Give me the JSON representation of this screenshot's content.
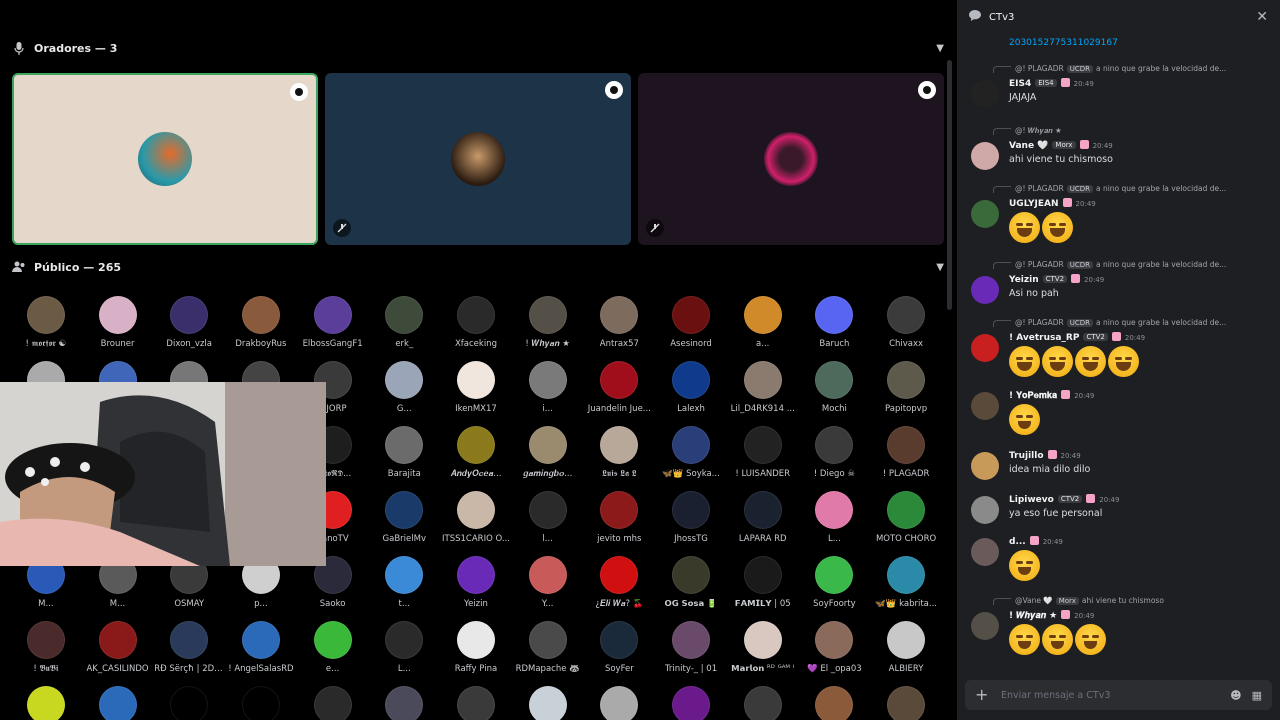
{
  "stage": {
    "speakers_label": "Oradores — 3",
    "audience_label": "Público — 265",
    "colors": {
      "tile1": "#e6d7cb",
      "tile2": "#1c3348",
      "tile3": "#1e1420",
      "tile1_border": "#3ba55d"
    }
  },
  "members": [
    {
      "name": "! 𝖒𝖔𝖗𝖋𝖔𝖗 ☯",
      "color": "#6b5a44"
    },
    {
      "name": "Brouner",
      "color": "#d9b1c6"
    },
    {
      "name": "Dixon_vzla",
      "color": "#3b2f6b"
    },
    {
      "name": "DrakboyRus",
      "color": "#8a5a3c"
    },
    {
      "name": "ElbossGangF1",
      "color": "#5a3e9a"
    },
    {
      "name": "erk_",
      "color": "#3e4a3a"
    },
    {
      "name": "Xfaceking",
      "color": "#2a2a2a"
    },
    {
      "name": "! 𝑾𝒉𝒚𝒂𝒏 ★",
      "color": "#555047"
    },
    {
      "name": "Antrax57",
      "color": "#7d6b5e"
    },
    {
      "name": "Asesinord",
      "color": "#6a1010"
    },
    {
      "name": "a...",
      "color": "#d08a2a"
    },
    {
      "name": "Baruch",
      "color": "#5865f2"
    },
    {
      "name": "Chivaxx",
      "color": "#3b3b3b"
    },
    {
      "name": "",
      "color": "#aaaaaa"
    },
    {
      "name": "",
      "color": "#3f66b8"
    },
    {
      "name": "",
      "color": "#777777"
    },
    {
      "name": "",
      "color": "#444444"
    },
    {
      "name": "IEJORP",
      "color": "#3a3a3a"
    },
    {
      "name": "G...",
      "color": "#9aa6b8"
    },
    {
      "name": "IkenMX17",
      "color": "#f0e6de"
    },
    {
      "name": "i...",
      "color": "#7a7a7a"
    },
    {
      "name": "Juandelin Jue...",
      "color": "#a10e1b"
    },
    {
      "name": "Lalexh",
      "color": "#103a8c"
    },
    {
      "name": "Lil_D4RK914 ...",
      "color": "#8a7b6e"
    },
    {
      "name": "Mochi",
      "color": "#4d6a5c"
    },
    {
      "name": "Papitopvp",
      "color": "#5d5a4b"
    },
    {
      "name": "",
      "color": "#000000"
    },
    {
      "name": "",
      "color": "#000000"
    },
    {
      "name": "",
      "color": "#000000"
    },
    {
      "name": "",
      "color": "#000000"
    },
    {
      "name": "𝕽𝖆𝖙𝖔𝕽𝕯...",
      "color": "#1e1e1e"
    },
    {
      "name": "Barajita",
      "color": "#6b6b6b"
    },
    {
      "name": "𝑨𝒏𝒅𝒚𝑶𝒄𝒆𝒂...",
      "color": "#8a7a1c"
    },
    {
      "name": "𝒈𝒂𝒎𝒊𝒏𝒈𝒃𝒐...",
      "color": "#9a8a6e"
    },
    {
      "name": "𝕷𝖚𝖎𝖘 𝕷𝖆 𝕷",
      "color": "#b8a89a"
    },
    {
      "name": "🦋👑 Soyka...",
      "color": "#2a3e7a"
    },
    {
      "name": "! LUISANDER",
      "color": "#222222"
    },
    {
      "name": "! Diego ☠",
      "color": "#3a3a3a"
    },
    {
      "name": "! PLAGADR",
      "color": "#5a3c2e"
    },
    {
      "name": "",
      "color": "#000000"
    },
    {
      "name": "",
      "color": "#000000"
    },
    {
      "name": "",
      "color": "#000000"
    },
    {
      "name": "",
      "color": "#000000"
    },
    {
      "name": "nanoTV",
      "color": "#e02020"
    },
    {
      "name": "GaBrielMv",
      "color": "#1a3a6a"
    },
    {
      "name": "ITSS1CARIO O...",
      "color": "#c9b8a8"
    },
    {
      "name": "l...",
      "color": "#2a2a2a"
    },
    {
      "name": "jevito mhs",
      "color": "#8c1a1a"
    },
    {
      "name": "JhossTG",
      "color": "#1a2030"
    },
    {
      "name": "LAPARA RD",
      "color": "#1a2230"
    },
    {
      "name": "L...",
      "color": "#e07aa8"
    },
    {
      "name": "MOTO CHORO",
      "color": "#2a8a3a"
    },
    {
      "name": "M...",
      "color": "#2a5ab8"
    },
    {
      "name": "M...",
      "color": "#5a5a5a"
    },
    {
      "name": "OSMAY",
      "color": "#3a3a3a"
    },
    {
      "name": "p...",
      "color": "#cfcfcf"
    },
    {
      "name": "Saoko",
      "color": "#2a2a3a"
    },
    {
      "name": "t...",
      "color": "#3a8ad8"
    },
    {
      "name": "Yeizin",
      "color": "#6a2ab8"
    },
    {
      "name": "Y...",
      "color": "#c85a5a"
    },
    {
      "name": "¿𝑬𝒍𝒊 𝑾𝒂? 🍒",
      "color": "#d01010"
    },
    {
      "name": "𝗢𝗚 𝗦𝗼𝘀𝗮 🔋",
      "color": "#3a3a2a"
    },
    {
      "name": "𝗙𝗔𝗠𝗜𝗟𝗬 | 05",
      "color": "#1a1a1a"
    },
    {
      "name": "SoyFoorty",
      "color": "#3ab84a"
    },
    {
      "name": "🦋👑 kabrita...",
      "color": "#2a8aa8"
    },
    {
      "name": "! 𝕭𝖚𝕭𝖎",
      "color": "#4a2a2a"
    },
    {
      "name": "AK_CASILINDO",
      "color": "#8a1a1a"
    },
    {
      "name": "RĐ Šërçħ | 2D ...",
      "color": "#2a3a5a"
    },
    {
      "name": "! AngelSalasRD",
      "color": "#2a6ab8"
    },
    {
      "name": "e...",
      "color": "#3ab83a"
    },
    {
      "name": "L...",
      "color": "#2a2a2a"
    },
    {
      "name": "Raffy Pina",
      "color": "#e8e8e8"
    },
    {
      "name": "RDMapache 🦝",
      "color": "#4a4a4a"
    },
    {
      "name": "SoyFer",
      "color": "#1a2a3a"
    },
    {
      "name": "Trinity-_ | 01",
      "color": "#6a4a6a"
    },
    {
      "name": "𝗠𝗮𝗿𝗹𝗼𝗻 ᴿᴰ ᴳᴬᴹ ᴵ",
      "color": "#d8c8c0"
    },
    {
      "name": "💜 El _opa03",
      "color": "#8a6a5a"
    },
    {
      "name": "ALBIERY",
      "color": "#c8c8c8"
    },
    {
      "name": "",
      "color": "#c8d820"
    },
    {
      "name": "",
      "color": "#2a6ab8"
    },
    {
      "name": "",
      "color": "#000000"
    },
    {
      "name": "",
      "color": "#000000"
    },
    {
      "name": "",
      "color": "#2a2a2a"
    },
    {
      "name": "",
      "color": "#4a4a5a"
    },
    {
      "name": "",
      "color": "#3a3a3a"
    },
    {
      "name": "",
      "color": "#c8d0d8"
    },
    {
      "name": "",
      "color": "#aaaaaa"
    },
    {
      "name": "",
      "color": "#6a1a8a"
    },
    {
      "name": "",
      "color": "#3a3a3a"
    },
    {
      "name": "",
      "color": "#8a5a3a"
    },
    {
      "name": "",
      "color": "#5a4a3a"
    }
  ],
  "chat": {
    "title": "CTv3",
    "link_text": "2030152775311029167",
    "input_placeholder": "Enviar mensaje a CTv3",
    "messages": [
      {
        "reply_author": "@! PLAGADR",
        "reply_tag": "UCDR",
        "reply_text": "a nino que grabe la velocidad de...",
        "author": "ΕΙS4",
        "tag": "EIS4",
        "time": "20:49",
        "text": "JAJAJA",
        "emoji": 0,
        "avatar": "#222222"
      },
      {
        "reply_author": "@! 𝑾𝒉𝒚𝒂𝒏 ★",
        "reply_tag": "",
        "reply_text": "",
        "author": "Vane 🤍",
        "tag": "Morx",
        "time": "20:49",
        "text": "ahi viene tu chismoso",
        "emoji": 0,
        "avatar": "#cfa8a8"
      },
      {
        "reply_author": "@! PLAGADR",
        "reply_tag": "UCDR",
        "reply_text": "a nino que grabe la velocidad de...",
        "author": "UGLYJEAN",
        "tag": "",
        "time": "20:49",
        "text": "",
        "emoji": 2,
        "kind": "laugh",
        "avatar": "#3a6a3a"
      },
      {
        "reply_author": "@! PLAGADR",
        "reply_tag": "UCDR",
        "reply_text": "a nino que grabe la velocidad de...",
        "author": "Yeizin",
        "tag": "CTV2",
        "time": "20:49",
        "text": "Asi no pah",
        "emoji": 0,
        "avatar": "#6a2ab8"
      },
      {
        "reply_author": "@! PLAGADR",
        "reply_tag": "UCDR",
        "reply_text": "a nino que grabe la velocidad de...",
        "author": "! Avetrusa_RP",
        "tag": "CTV2",
        "time": "20:49",
        "text": "",
        "emoji": 4,
        "kind": "laugh",
        "avatar": "#c82020"
      },
      {
        "reply_author": "",
        "reply_tag": "",
        "reply_text": "",
        "author": "! 𝐘𝐨𝐏𝐞𝐦𝐤𝐚",
        "tag": "",
        "time": "20:49",
        "text": "",
        "emoji": 1,
        "kind": "cry",
        "avatar": "#5a4a3a"
      },
      {
        "reply_author": "",
        "reply_tag": "",
        "reply_text": "",
        "author": "Trujillo",
        "tag": "",
        "time": "20:49",
        "text": "idea mia dilo dilo",
        "emoji": 0,
        "avatar": "#c89a5a"
      },
      {
        "reply_author": "",
        "reply_tag": "",
        "reply_text": "",
        "author": "Lipiwevo",
        "tag": "CTV2",
        "time": "20:49",
        "text": "ya eso fue personal",
        "emoji": 0,
        "avatar": "#8a8a8a"
      },
      {
        "reply_author": "",
        "reply_tag": "",
        "reply_text": "",
        "author": "d...",
        "tag": "",
        "time": "20:49",
        "text": "",
        "emoji": 1,
        "kind": "cry",
        "avatar": "#6a5a5a"
      },
      {
        "reply_author": "@Vane 🤍",
        "reply_tag": "Morx",
        "reply_text": "ahi viene tu chismoso",
        "author": "! 𝑾𝒉𝒚𝒂𝒏 ★",
        "tag": "",
        "time": "20:49",
        "text": "",
        "emoji": 3,
        "kind": "cry",
        "avatar": "#555047"
      }
    ]
  }
}
